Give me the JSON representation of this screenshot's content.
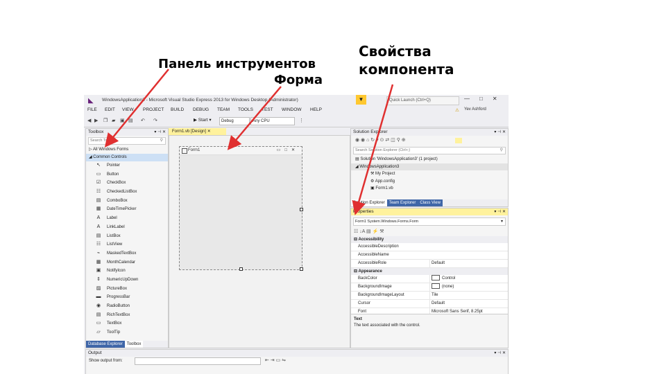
{
  "annotations": {
    "toolbox_line1": "Панель инструментов",
    "toolbox_line2": "Форма",
    "props_line1": "Свойства",
    "props_line2": "компонента"
  },
  "window": {
    "title": "WindowsApplication3 - Microsoft Visual Studio Express 2013 for Windows Desktop (Administrator)",
    "quick_launch": "Quick Launch (Ctrl+Q)",
    "user": "Yev Ashford",
    "controls": [
      "—",
      "□",
      "✕"
    ]
  },
  "menu": [
    "FILE",
    "EDIT",
    "VIEW",
    "PROJECT",
    "BUILD",
    "DEBUG",
    "TEAM",
    "TOOLS",
    "TEST",
    "WINDOW",
    "HELP"
  ],
  "toolbar": {
    "start": "▶ Start ▾",
    "config": "Debug",
    "platform": "Any CPU"
  },
  "toolbox": {
    "title": "Toolbox",
    "search_placeholder": "Search Toolbox",
    "group_all": "▷ All Windows Forms",
    "group_common": "◢ Common Controls",
    "items": [
      {
        "icon": "↖",
        "label": "Pointer"
      },
      {
        "icon": "▭",
        "label": "Button"
      },
      {
        "icon": "☑",
        "label": "CheckBox"
      },
      {
        "icon": "☷",
        "label": "CheckedListBox"
      },
      {
        "icon": "▤",
        "label": "ComboBox"
      },
      {
        "icon": "▦",
        "label": "DateTimePicker"
      },
      {
        "icon": "A",
        "label": "Label"
      },
      {
        "icon": "A",
        "label": "LinkLabel"
      },
      {
        "icon": "▤",
        "label": "ListBox"
      },
      {
        "icon": "☷",
        "label": "ListView"
      },
      {
        "icon": "⌁",
        "label": "MaskedTextBox"
      },
      {
        "icon": "▦",
        "label": "MonthCalendar"
      },
      {
        "icon": "▣",
        "label": "NotifyIcon"
      },
      {
        "icon": "⇕",
        "label": "NumericUpDown"
      },
      {
        "icon": "▨",
        "label": "PictureBox"
      },
      {
        "icon": "▬",
        "label": "ProgressBar"
      },
      {
        "icon": "◉",
        "label": "RadioButton"
      },
      {
        "icon": "▤",
        "label": "RichTextBox"
      },
      {
        "icon": "▭",
        "label": "TextBox"
      },
      {
        "icon": "▱",
        "label": "ToolTip"
      }
    ],
    "tab_db": "Database Explorer",
    "tab_toolbox": "Toolbox"
  },
  "designer": {
    "tab_label": "Form1.vb [Design]",
    "form_title": "Form1"
  },
  "solution_explorer": {
    "title": "Solution Explorer",
    "search_placeholder": "Search Solution Explorer (Ctrl+;)",
    "tree": [
      "Solution 'WindowsApplication3' (1 project)",
      "◢ WindowsApplication3",
      "My Project",
      "App.config",
      "Form1.vb"
    ],
    "tabs": [
      "Solution Explorer",
      "Team Explorer",
      "Class View"
    ]
  },
  "properties": {
    "title": "Properties",
    "object": "Form1  System.Windows.Forms.Form",
    "categories": [
      {
        "name": "Accessibility",
        "rows": [
          {
            "name": "AccessibleDescription",
            "value": ""
          },
          {
            "name": "AccessibleName",
            "value": ""
          },
          {
            "name": "AccessibleRole",
            "value": "Default"
          }
        ]
      },
      {
        "name": "Appearance",
        "rows": [
          {
            "name": "BackColor",
            "value": "Control",
            "swatch": true
          },
          {
            "name": "BackgroundImage",
            "value": "(none)",
            "swatch": true
          },
          {
            "name": "BackgroundImageLayout",
            "value": "Tile"
          },
          {
            "name": "Cursor",
            "value": "Default"
          },
          {
            "name": "Font",
            "value": "Microsoft Sans Serif, 8.25pt"
          }
        ]
      }
    ],
    "desc_title": "Text",
    "desc_text": "The text associated with the control."
  },
  "output": {
    "title": "Output",
    "show_from": "Show output from:"
  },
  "colors": {
    "annotation_arrow": "#e03030",
    "active_header": "#fff29d",
    "vs_purple": "#68217a"
  }
}
